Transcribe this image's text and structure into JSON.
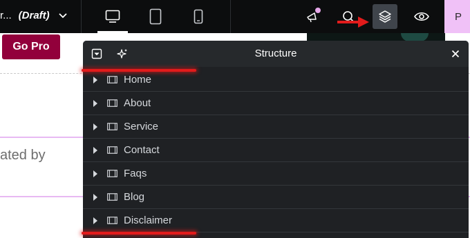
{
  "topbar": {
    "title_fragment": "r...",
    "status": "(Draft)",
    "devices": [
      "desktop-icon",
      "tablet-icon",
      "mobile-icon"
    ],
    "tools": [
      "whats-new-icon",
      "search-icon",
      "structure-icon",
      "preview-icon"
    ],
    "publish_fragment": "P"
  },
  "canvas": {
    "go_pro_label": "Go Pro",
    "text_fragment": "ated by",
    "right_fragment": "("
  },
  "structure_panel": {
    "title": "Structure",
    "items": [
      {
        "label": "Home"
      },
      {
        "label": "About"
      },
      {
        "label": "Service"
      },
      {
        "label": "Contact"
      },
      {
        "label": "Faqs"
      },
      {
        "label": "Blog"
      },
      {
        "label": "Disclaimer"
      }
    ]
  },
  "colors": {
    "topbar_bg": "#0c0d0e",
    "panel_bg": "#1f2124",
    "go_pro_bg": "#92003b",
    "publish_bg": "#f0c1f7",
    "annotation_red": "#e21b1b",
    "notification_dot": "#e6a7e9"
  }
}
